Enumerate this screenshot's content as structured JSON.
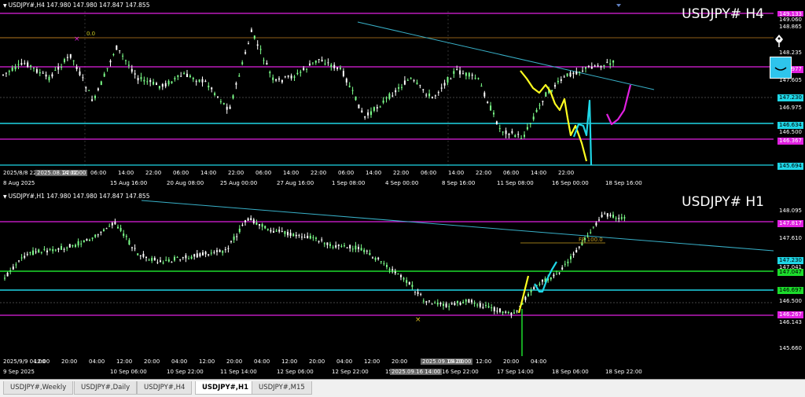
{
  "chart_data": [
    {
      "type": "candlestick",
      "title": "USDJPY#,H4",
      "symbol_label": "USDJPY# H4",
      "header": "USDJPY#,H4  147.980 147.980 147.847 147.855",
      "price_labels": [
        "149.133",
        "149.060",
        "148.865",
        "148.235",
        "147.977",
        "147.605",
        "147.230",
        "146.975",
        "146.634",
        "146.500",
        "146.367",
        "145.694"
      ],
      "time_labels": [
        "8 Aug 2025",
        "15 Aug 16:00",
        "20 Aug 08:00",
        "25 Aug 00:00",
        "27 Aug 16:00",
        "1 Sep 08:00",
        "4 Sep 00:00",
        "8 Sep 16:00",
        "11 Sep 08:00",
        "16 Sep 00:00",
        "18 Sep 16:00"
      ],
      "crosshair_labels": [
        "2025/8/8 22:00",
        "2025.08.14 02:00",
        "22:00",
        "06:00",
        "14:00",
        "22:00",
        "06:00",
        "14:00",
        "22:00",
        "06:00",
        "14:00",
        "22:00",
        "06:00",
        "14:00",
        "22:00",
        "06:00",
        "14:00",
        "22:00",
        "06:00",
        "14:00",
        "22:00"
      ],
      "fib_label": "0.0",
      "horizontal_lines": [
        149.133,
        147.977,
        147.23,
        146.634,
        146.367,
        145.694
      ]
    },
    {
      "type": "candlestick",
      "title": "USDJPY#,H1",
      "symbol_label": "USDJPY# H1",
      "header": "USDJPY#,H1  147.980 147.980 147.847 147.855",
      "price_labels": [
        "148.095",
        "147.817",
        "147.610",
        "147.230",
        "147.041",
        "147.047",
        "146.697",
        "146.500",
        "146.267",
        "146.143",
        "145.660"
      ],
      "time_labels": [
        "9 Sep 2025",
        "10 Sep 06:00",
        "10 Sep 22:00",
        "11 Sep 14:00",
        "12 Sep 06:00",
        "12 Sep 22:00",
        "15 Sep 14:00",
        "16 Sep 22:00",
        "17 Sep 14:00",
        "18 Sep 06:00",
        "18 Sep 22:00"
      ],
      "crosshair_labels": [
        "2025/9/9 04:00",
        "12:00",
        "20:00",
        "04:00",
        "12:00",
        "20:00",
        "04:00",
        "12:00",
        "20:00",
        "04:00",
        "12:00",
        "20:00",
        "04:00",
        "12:00",
        "20:00",
        "2025.09.16 20:00",
        "04:00",
        "12:00",
        "20:00",
        "04:00"
      ],
      "crosshair_time": "2025.09.16 14:00",
      "fib_label": "FE 100.0",
      "horizontal_lines": [
        147.817,
        147.23,
        147.041,
        146.697,
        146.267
      ]
    }
  ],
  "tabs": [
    "USDJPY#,Weekly",
    "USDJPY#,Daily",
    "USDJPY#,H4",
    "USDJPY#,H1",
    "USDJPY#,M15"
  ],
  "active_tab": "USDJPY#,H1",
  "colors": {
    "bull": "#7dff8a",
    "bear": "#ffffff",
    "magenta": "#e020e0",
    "cyan": "#1fd6e6",
    "trend": "#38b0c8",
    "green_line": "#1cdc2c",
    "yellow": "#ffff20",
    "orange": "#c8a020"
  }
}
